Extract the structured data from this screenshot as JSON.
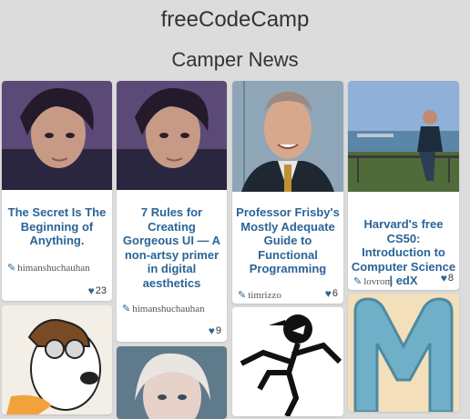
{
  "header": {
    "brand": "freeCodeCamp",
    "title": "Camper News"
  },
  "cards": [
    {
      "headline": "The Secret Is The Beginning of Anything.",
      "author": "himanshuchauhan",
      "likes": "23"
    },
    {
      "headline": "7 Rules for Creating Gorgeous UI — A non-artsy primer in digital aesthetics",
      "author": "himanshuchauhan",
      "likes": "9"
    },
    {
      "headline": "Professor Frisby's Mostly Adequate Guide to Functional Programming",
      "author": "timrizzo",
      "likes": "6"
    },
    {
      "headline": "Harvard's free CS50: Introduction to Computer Science | edX",
      "author": "lovrom",
      "likes": "8"
    }
  ],
  "icons": {
    "author": "pencil-icon",
    "likes": "heart-icon"
  },
  "colors": {
    "link": "#2a6496",
    "background": "#dcdcdc"
  }
}
